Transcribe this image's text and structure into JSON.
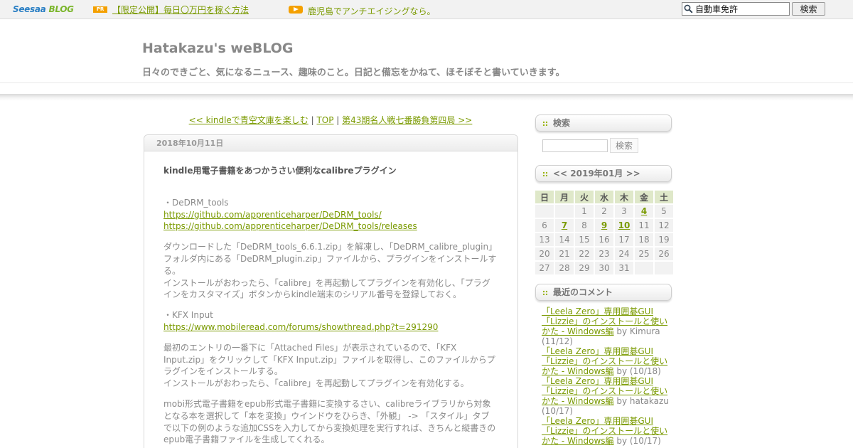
{
  "topbar": {
    "logo_main": "Seesaa",
    "logo_blog": "BLOG",
    "pr_badge": "PR",
    "pr_link": "【限定公開】毎日〇万円を稼ぐ方法",
    "ad_link": "鹿児島でアンチエイジングなら。",
    "search_value": "自動車免許",
    "search_button": "検索"
  },
  "header": {
    "title": "Hatakazu's weBLOG",
    "description": "日々のできごと、気になるニュース、趣味のこと。日記と備忘をかねて、ほそぼそと書いていきます。"
  },
  "pager": {
    "prev": "<< kindleで青空文庫を楽しむ",
    "sep1": " | ",
    "top": "TOP",
    "sep2": " | ",
    "next": "第43期名人戦七番勝負第四局 >>"
  },
  "entry": {
    "date": "2018年10月11日",
    "title": "kindle用電子書籍をあつかうさい便利なcalibreプラグイン",
    "section1_label": "・DeDRM_tools",
    "section1_link1": "https://github.com/apprenticeharper/DeDRM_tools/",
    "section1_link2": "https://github.com/apprenticeharper/DeDRM_tools/releases",
    "para1": "ダウンロードした「DeDRM_tools_6.6.1.zip」を解凍し、「DeDRM_calibre_plugin」フォルダ内にある「DeDRM_plugin.zip」ファイルから、プラグインをインストールする。",
    "para1b": "インストールがおわったら、「calibre」を再起動してプラグインを有効化し、「プラグインをカスタマイズ」ボタンからkindle端末のシリアル番号を登録しておく。",
    "section2_label": "・KFX Input",
    "section2_link": "https://www.mobileread.com/forums/showthread.php?t=291290",
    "para2": "最初のエントリの一番下に「Attached Files」が表示されているので、「KFX Input.zip」をクリックして「KFX Input.zip」ファイルを取得し、このファイルからプラグインをインストールする。",
    "para2b": "インストールがおわったら、「calibre」を再起動してプラグインを有効化する。",
    "para3": "mobi形式電子書籍をepub形式電子書籍に変換するさい、calibreライブラリから対象となる本を選択して「本を変換」ウインドウをひらき、「外観」 -> 「スタイル」タブで以下の例のような追加CSSを入力してから変換処理を実行すれば、きちんと縦書きのepub電子書籍ファイルを生成してくれる。"
  },
  "sidebar": {
    "search_title": "検索",
    "search_button": "検索",
    "calendar_title": "<< 2019年01月 >>",
    "weekdays": [
      "日",
      "月",
      "火",
      "水",
      "木",
      "金",
      "土"
    ],
    "weeks": [
      [
        "",
        "",
        "1",
        "2",
        "3",
        "4",
        "5"
      ],
      [
        "6",
        "7",
        "8",
        "9",
        "10",
        "11",
        "12"
      ],
      [
        "13",
        "14",
        "15",
        "16",
        "17",
        "18",
        "19"
      ],
      [
        "20",
        "21",
        "22",
        "23",
        "24",
        "25",
        "26"
      ],
      [
        "27",
        "28",
        "29",
        "30",
        "31",
        "",
        ""
      ]
    ],
    "linked_days": [
      "4",
      "7",
      "9",
      "10"
    ],
    "comments_title": "最近のコメント",
    "comments": [
      {
        "link": "「Leela Zero」専用囲碁GUI「Lizzie」のインストールと使いかた - Windows編",
        "by": " by Kimura (11/12)"
      },
      {
        "link": "「Leela Zero」専用囲碁GUI「Lizzie」のインストールと使いかた - Windows編",
        "by": " by  (10/18)"
      },
      {
        "link": "「Leela Zero」専用囲碁GUI「Lizzie」のインストールと使いかた - Windows編",
        "by": " by hatakazu (10/17)"
      },
      {
        "link": "「Leela Zero」専用囲碁GUI「Lizzie」のインストールと使いかた - Windows編",
        "by": " by  (10/17)"
      }
    ]
  },
  "colors": {
    "link": "#7a9a00",
    "accent_orange": "#f4a000",
    "calendar_header": "#dfe8c9"
  }
}
